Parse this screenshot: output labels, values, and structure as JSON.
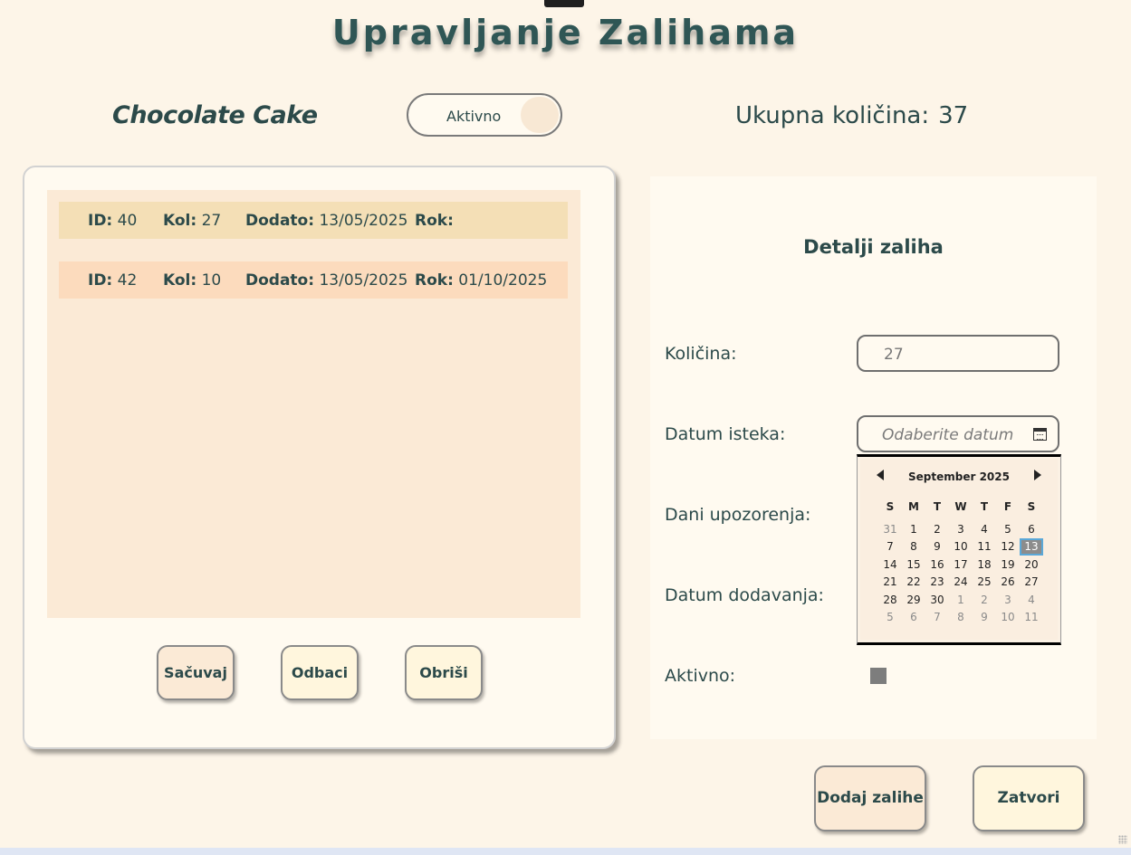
{
  "title": "Upravljanje Zalihama",
  "product": {
    "name": "Chocolate Cake",
    "status_toggle": "Aktivno",
    "total_label": "Ukupna količina:",
    "total_value": "37"
  },
  "stock_list": {
    "rows": [
      {
        "id_label": "ID:",
        "id": "40",
        "kol_label": "Kol:",
        "kol": "27",
        "dodato_label": "Dodato:",
        "dodato": "13/05/2025",
        "rok_label": "Rok:",
        "rok": ""
      },
      {
        "id_label": "ID:",
        "id": "42",
        "kol_label": "Kol:",
        "kol": "10",
        "dodato_label": "Dodato:",
        "dodato": "13/05/2025",
        "rok_label": "Rok:",
        "rok": "01/10/2025"
      }
    ],
    "buttons": {
      "save": "Sačuvaj",
      "discard": "Odbaci",
      "delete": "Obriši"
    }
  },
  "details": {
    "title": "Detalji zaliha",
    "quantity_label": "Količina:",
    "quantity_value": "27",
    "expiry_label": "Datum isteka:",
    "expiry_placeholder": "Odaberite datum",
    "warning_days_label": "Dani upozorenja:",
    "date_added_label": "Datum dodavanja:",
    "active_label": "Aktivno:"
  },
  "calendar": {
    "month": "September 2025",
    "weekdays": [
      "S",
      "M",
      "T",
      "W",
      "T",
      "F",
      "S"
    ],
    "weeks": [
      [
        "31",
        "1",
        "2",
        "3",
        "4",
        "5",
        "6"
      ],
      [
        "7",
        "8",
        "9",
        "10",
        "11",
        "12",
        "13"
      ],
      [
        "14",
        "15",
        "16",
        "17",
        "18",
        "19",
        "20"
      ],
      [
        "21",
        "22",
        "23",
        "24",
        "25",
        "26",
        "27"
      ],
      [
        "28",
        "29",
        "30",
        "1",
        "2",
        "3",
        "4"
      ],
      [
        "5",
        "6",
        "7",
        "8",
        "9",
        "10",
        "11"
      ]
    ],
    "selected": "13"
  },
  "actions": {
    "add_stock": "Dodaj zalihe",
    "close": "Zatvori"
  }
}
